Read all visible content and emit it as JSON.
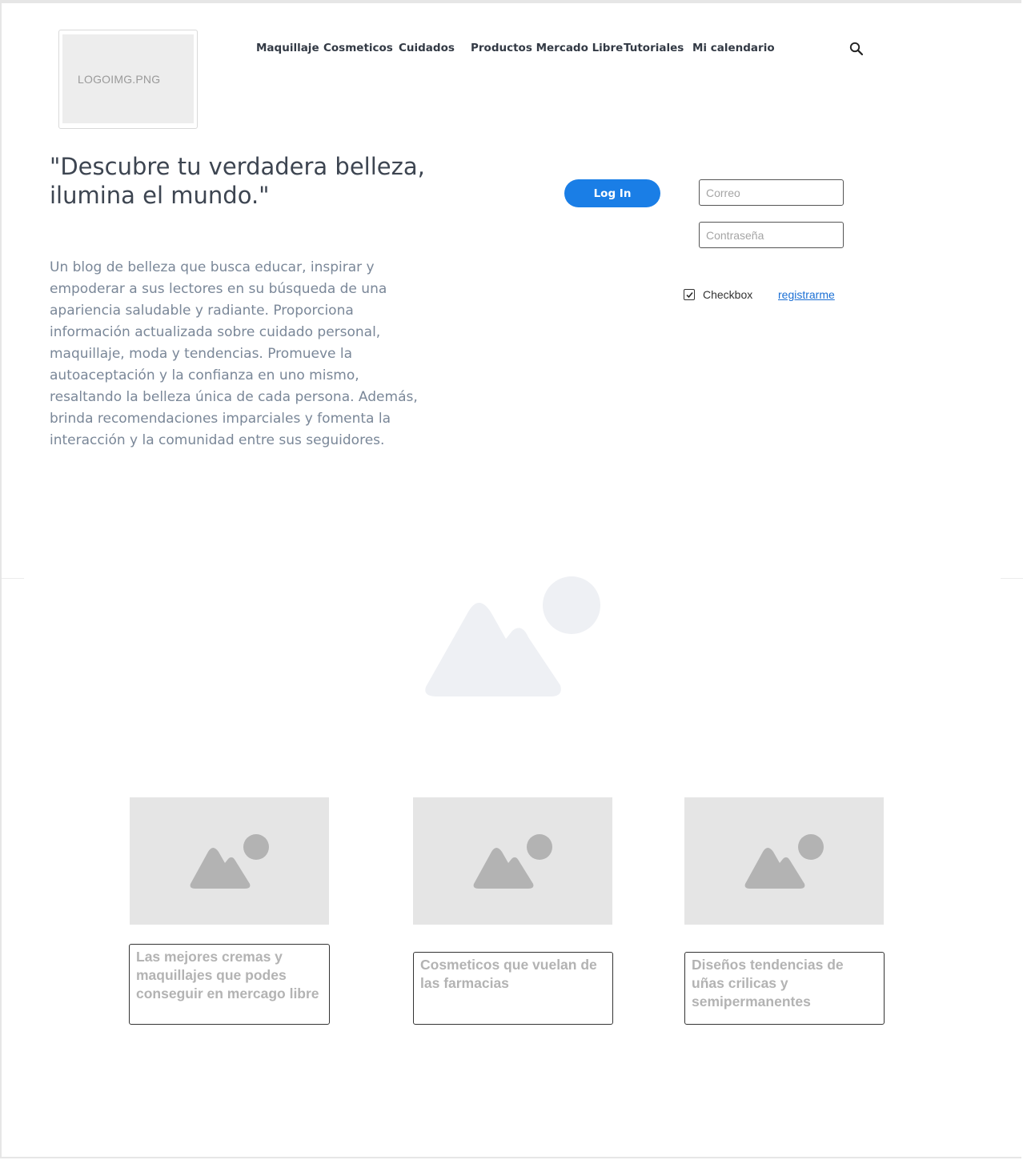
{
  "logo": {
    "text": "LOGOIMG.PNG"
  },
  "nav": {
    "items": [
      {
        "label": "Maquillaje"
      },
      {
        "label": "Cosmeticos"
      },
      {
        "label": "Cuidados"
      },
      {
        "label": "Productos Mercado Libre"
      },
      {
        "label": "Tutoriales"
      },
      {
        "label": "Mi calendario"
      }
    ],
    "search_icon": "search-icon"
  },
  "hero": {
    "headline": "\"Descubre tu verdadera belleza, ilumina el mundo.\"",
    "description": "Un blog de belleza que busca educar, inspirar y empoderar a sus lectores en su búsqueda de una apariencia saludable y radiante. Proporciona información actualizada sobre cuidado personal, maquillaje, moda y tendencias. Promueve la autoaceptación y la confianza en uno mismo, resaltando la belleza única de cada persona. Además, brinda recomendaciones imparciales y fomenta la interacción y la comunidad entre sus seguidores."
  },
  "login": {
    "button_label": "Log In",
    "email_placeholder": "Correo",
    "password_placeholder": "Contraseña",
    "checkbox_label": "Checkbox",
    "checkbox_checked": true,
    "register_link": "registrarme"
  },
  "cards": [
    {
      "caption": "Las mejores cremas y maquillajes que podes conseguir en mercago libre"
    },
    {
      "caption": "Cosmeticos que vuelan de las farmacias"
    },
    {
      "caption": "Diseños tendencias de uñas crilicas y semipermanentes"
    }
  ],
  "colors": {
    "accent": "#1a7ee6",
    "link": "#1a6fd4",
    "placeholder_bg": "#e5e5e5"
  }
}
